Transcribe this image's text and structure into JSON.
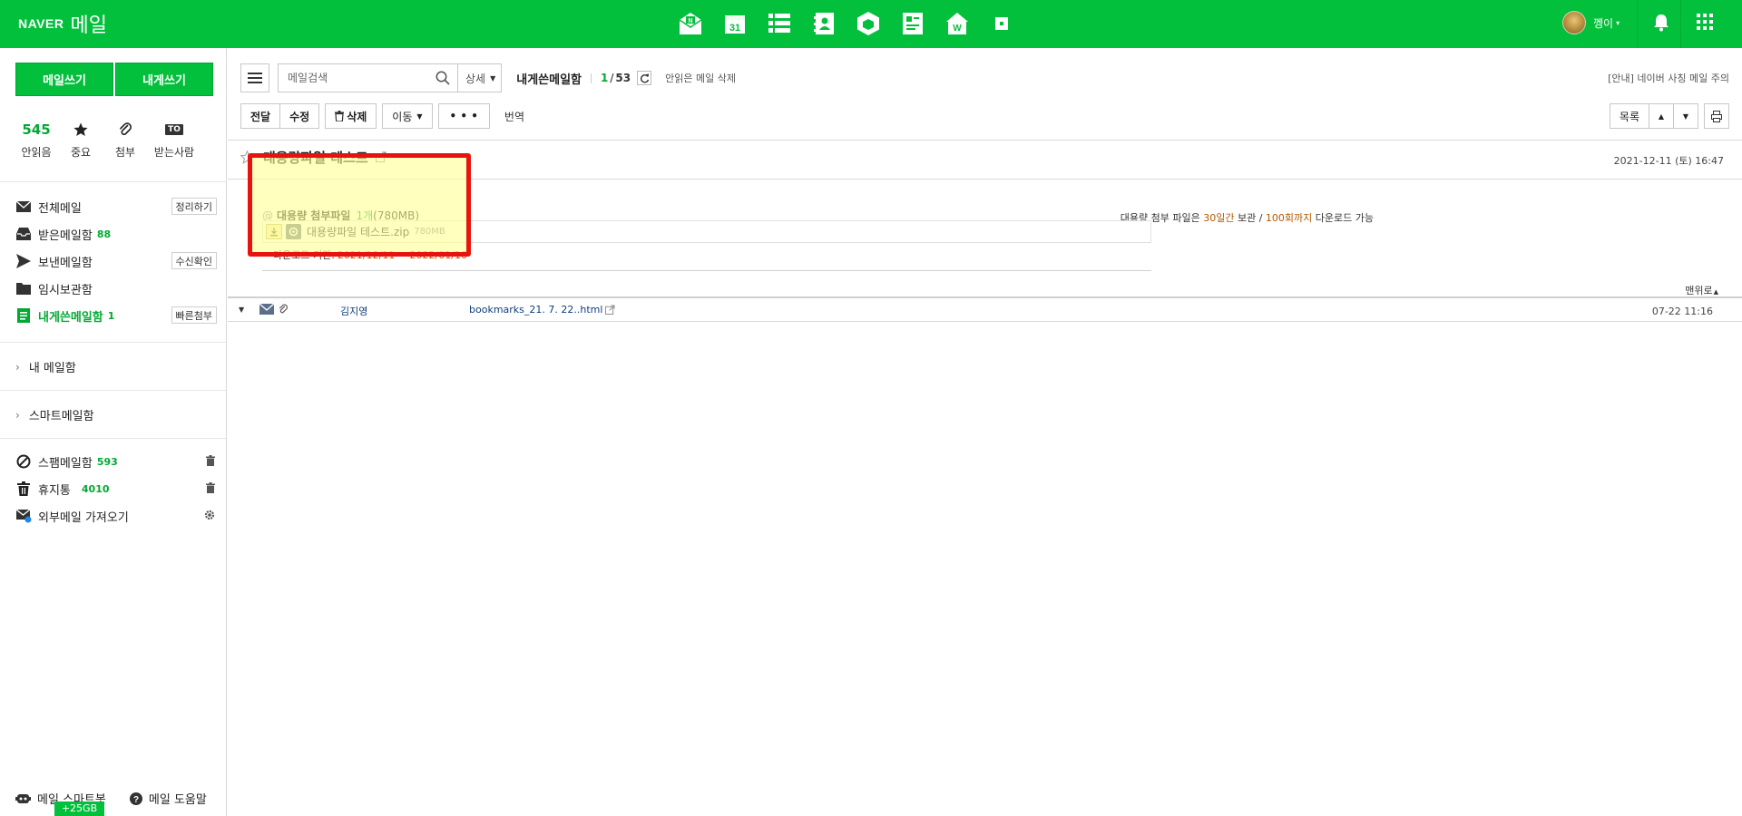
{
  "header": {
    "brand_naver": "NAVER",
    "brand_mail": "메일",
    "apps": [
      "mail-home-icon",
      "calendar-icon",
      "list-icon",
      "contacts-icon",
      "box-icon",
      "memo-icon",
      "house-icon",
      "small-app-icon"
    ],
    "calendar_number": "31",
    "profile_name": "껭이",
    "accent_color": "#03c03c"
  },
  "sidebar": {
    "compose_label": "메일쓰기",
    "self_compose_label": "내게쓰기",
    "quick": {
      "unread_count": "545",
      "unread_label": "안읽음",
      "important_label": "중요",
      "attach_label": "첨부",
      "to_badge": "TO",
      "recipient_label": "받는사람"
    },
    "mailboxes": [
      {
        "label": "전체메일",
        "count": "",
        "button": "정리하기"
      },
      {
        "label": "받은메일함",
        "count": "88",
        "button": ""
      },
      {
        "label": "보낸메일함",
        "count": "",
        "button": "수신확인"
      },
      {
        "label": "임시보관함",
        "count": "",
        "button": ""
      },
      {
        "label": "내게쓴메일함",
        "count": "1",
        "button": "빠른첨부"
      }
    ],
    "my_mailbox_label": "내 메일함",
    "smart_mailbox_label": "스마트메일함",
    "extra": [
      {
        "label": "스팸메일함",
        "count": "593"
      },
      {
        "label": "휴지통",
        "count": "4010"
      },
      {
        "label": "외부메일 가져오기",
        "count": ""
      }
    ],
    "bottom": {
      "smartbot_label": "메일 스마트봇",
      "help_label": "메일 도움말",
      "storage_badge": "+25GB"
    }
  },
  "toolbar": {
    "search_placeholder": "메일검색",
    "detail_label": "상세",
    "folder_title": "내게쓴메일함",
    "page_current": "1",
    "page_total": "53",
    "unread_delete": "안읽은 메일 삭제",
    "notice": "[안내] 네이버 사칭 메일 주의",
    "forward": "전달",
    "edit": "수정",
    "delete": "삭제",
    "move": "이동",
    "more": "• • •",
    "translate": "번역",
    "list": "목록"
  },
  "message": {
    "subject": "대용량파일 테스트",
    "date": "2021-12-11 (토) 16:47",
    "bigfile": {
      "title": "대용량 첨부파일",
      "count": "1개",
      "size_total": "(780MB)",
      "info_prefix": "대용량 첨부 파일은 ",
      "info_days": "30일간",
      "info_mid": " 보관 / ",
      "info_times": "100회까지",
      "info_suffix": " 다운로드 가능",
      "file_name": "대용량파일 테스트.zip",
      "file_size": "780MB",
      "period_label": "다운로드 기간:",
      "period_range": "2021/12/11 ~ 2022/01/10"
    }
  },
  "list": {
    "go_top": "맨위로",
    "rows": [
      {
        "sender": "김지영",
        "subject": "bookmarks_21. 7. 22..html",
        "date": "07-22 11:16"
      }
    ]
  }
}
